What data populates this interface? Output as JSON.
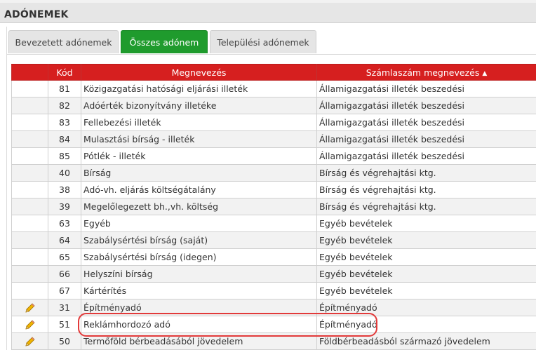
{
  "page": {
    "title": "ADÓNEMEK"
  },
  "tabs": [
    {
      "label": "Bevezetett adónemek",
      "active": false
    },
    {
      "label": "Összes adónem",
      "active": true
    },
    {
      "label": "Települési adónemek",
      "active": false
    }
  ],
  "table": {
    "columns": {
      "icon": "",
      "kod": "Kód",
      "megnevezes": "Megnevezés",
      "szamlaszam": "Számlaszám megnevezés"
    },
    "sort_icon": "sort-icon",
    "rows": [
      {
        "edit": false,
        "kod": "81",
        "megnevezes": "Közigazgatási hatósági eljárási illeték",
        "szamlaszam": "Államigazgatási illeték beszedési"
      },
      {
        "edit": false,
        "kod": "82",
        "megnevezes": "Adóérték bizonyítvány illetéke",
        "szamlaszam": "Államigazgatási illeték beszedési"
      },
      {
        "edit": false,
        "kod": "83",
        "megnevezes": "Fellebezési illeték",
        "szamlaszam": "Államigazgatási illeték beszedési"
      },
      {
        "edit": false,
        "kod": "84",
        "megnevezes": "Mulasztási bírság - illeték",
        "szamlaszam": "Államigazgatási illeték beszedési"
      },
      {
        "edit": false,
        "kod": "85",
        "megnevezes": "Pótlék - illeték",
        "szamlaszam": "Államigazgatási illeték beszedési"
      },
      {
        "edit": false,
        "kod": "40",
        "megnevezes": "Bírság",
        "szamlaszam": "Bírság és végrehajtási ktg."
      },
      {
        "edit": false,
        "kod": "38",
        "megnevezes": "Adó-vh. eljárás költségátalány",
        "szamlaszam": "Bírság és végrehajtási ktg."
      },
      {
        "edit": false,
        "kod": "39",
        "megnevezes": "Megelőlegezett bh.,vh. költség",
        "szamlaszam": "Bírság és végrehajtási ktg."
      },
      {
        "edit": false,
        "kod": "63",
        "megnevezes": "Egyéb",
        "szamlaszam": "Egyéb bevételek"
      },
      {
        "edit": false,
        "kod": "64",
        "megnevezes": "Szabálysértési bírság (saját)",
        "szamlaszam": "Egyéb bevételek"
      },
      {
        "edit": false,
        "kod": "65",
        "megnevezes": "Szabálysértési bírság (idegen)",
        "szamlaszam": "Egyéb bevételek"
      },
      {
        "edit": false,
        "kod": "66",
        "megnevezes": "Helyszíni bírság",
        "szamlaszam": "Egyéb bevételek"
      },
      {
        "edit": false,
        "kod": "67",
        "megnevezes": "Kártérítés",
        "szamlaszam": "Egyéb bevételek"
      },
      {
        "edit": true,
        "kod": "31",
        "megnevezes": "Építményadó",
        "szamlaszam": "Építményadó"
      },
      {
        "edit": true,
        "kod": "51",
        "megnevezes": "Reklámhordozó adó",
        "szamlaszam": "Építményadó"
      },
      {
        "edit": true,
        "kod": "50",
        "megnevezes": "Termőföld bérbeadásából jövedelem",
        "szamlaszam": "Földbérbeadásból származó jövedelem"
      }
    ]
  },
  "colors": {
    "header_red": "#d61f1f",
    "tab_active": "#1f9b2d",
    "highlight": "#e23a3a"
  }
}
